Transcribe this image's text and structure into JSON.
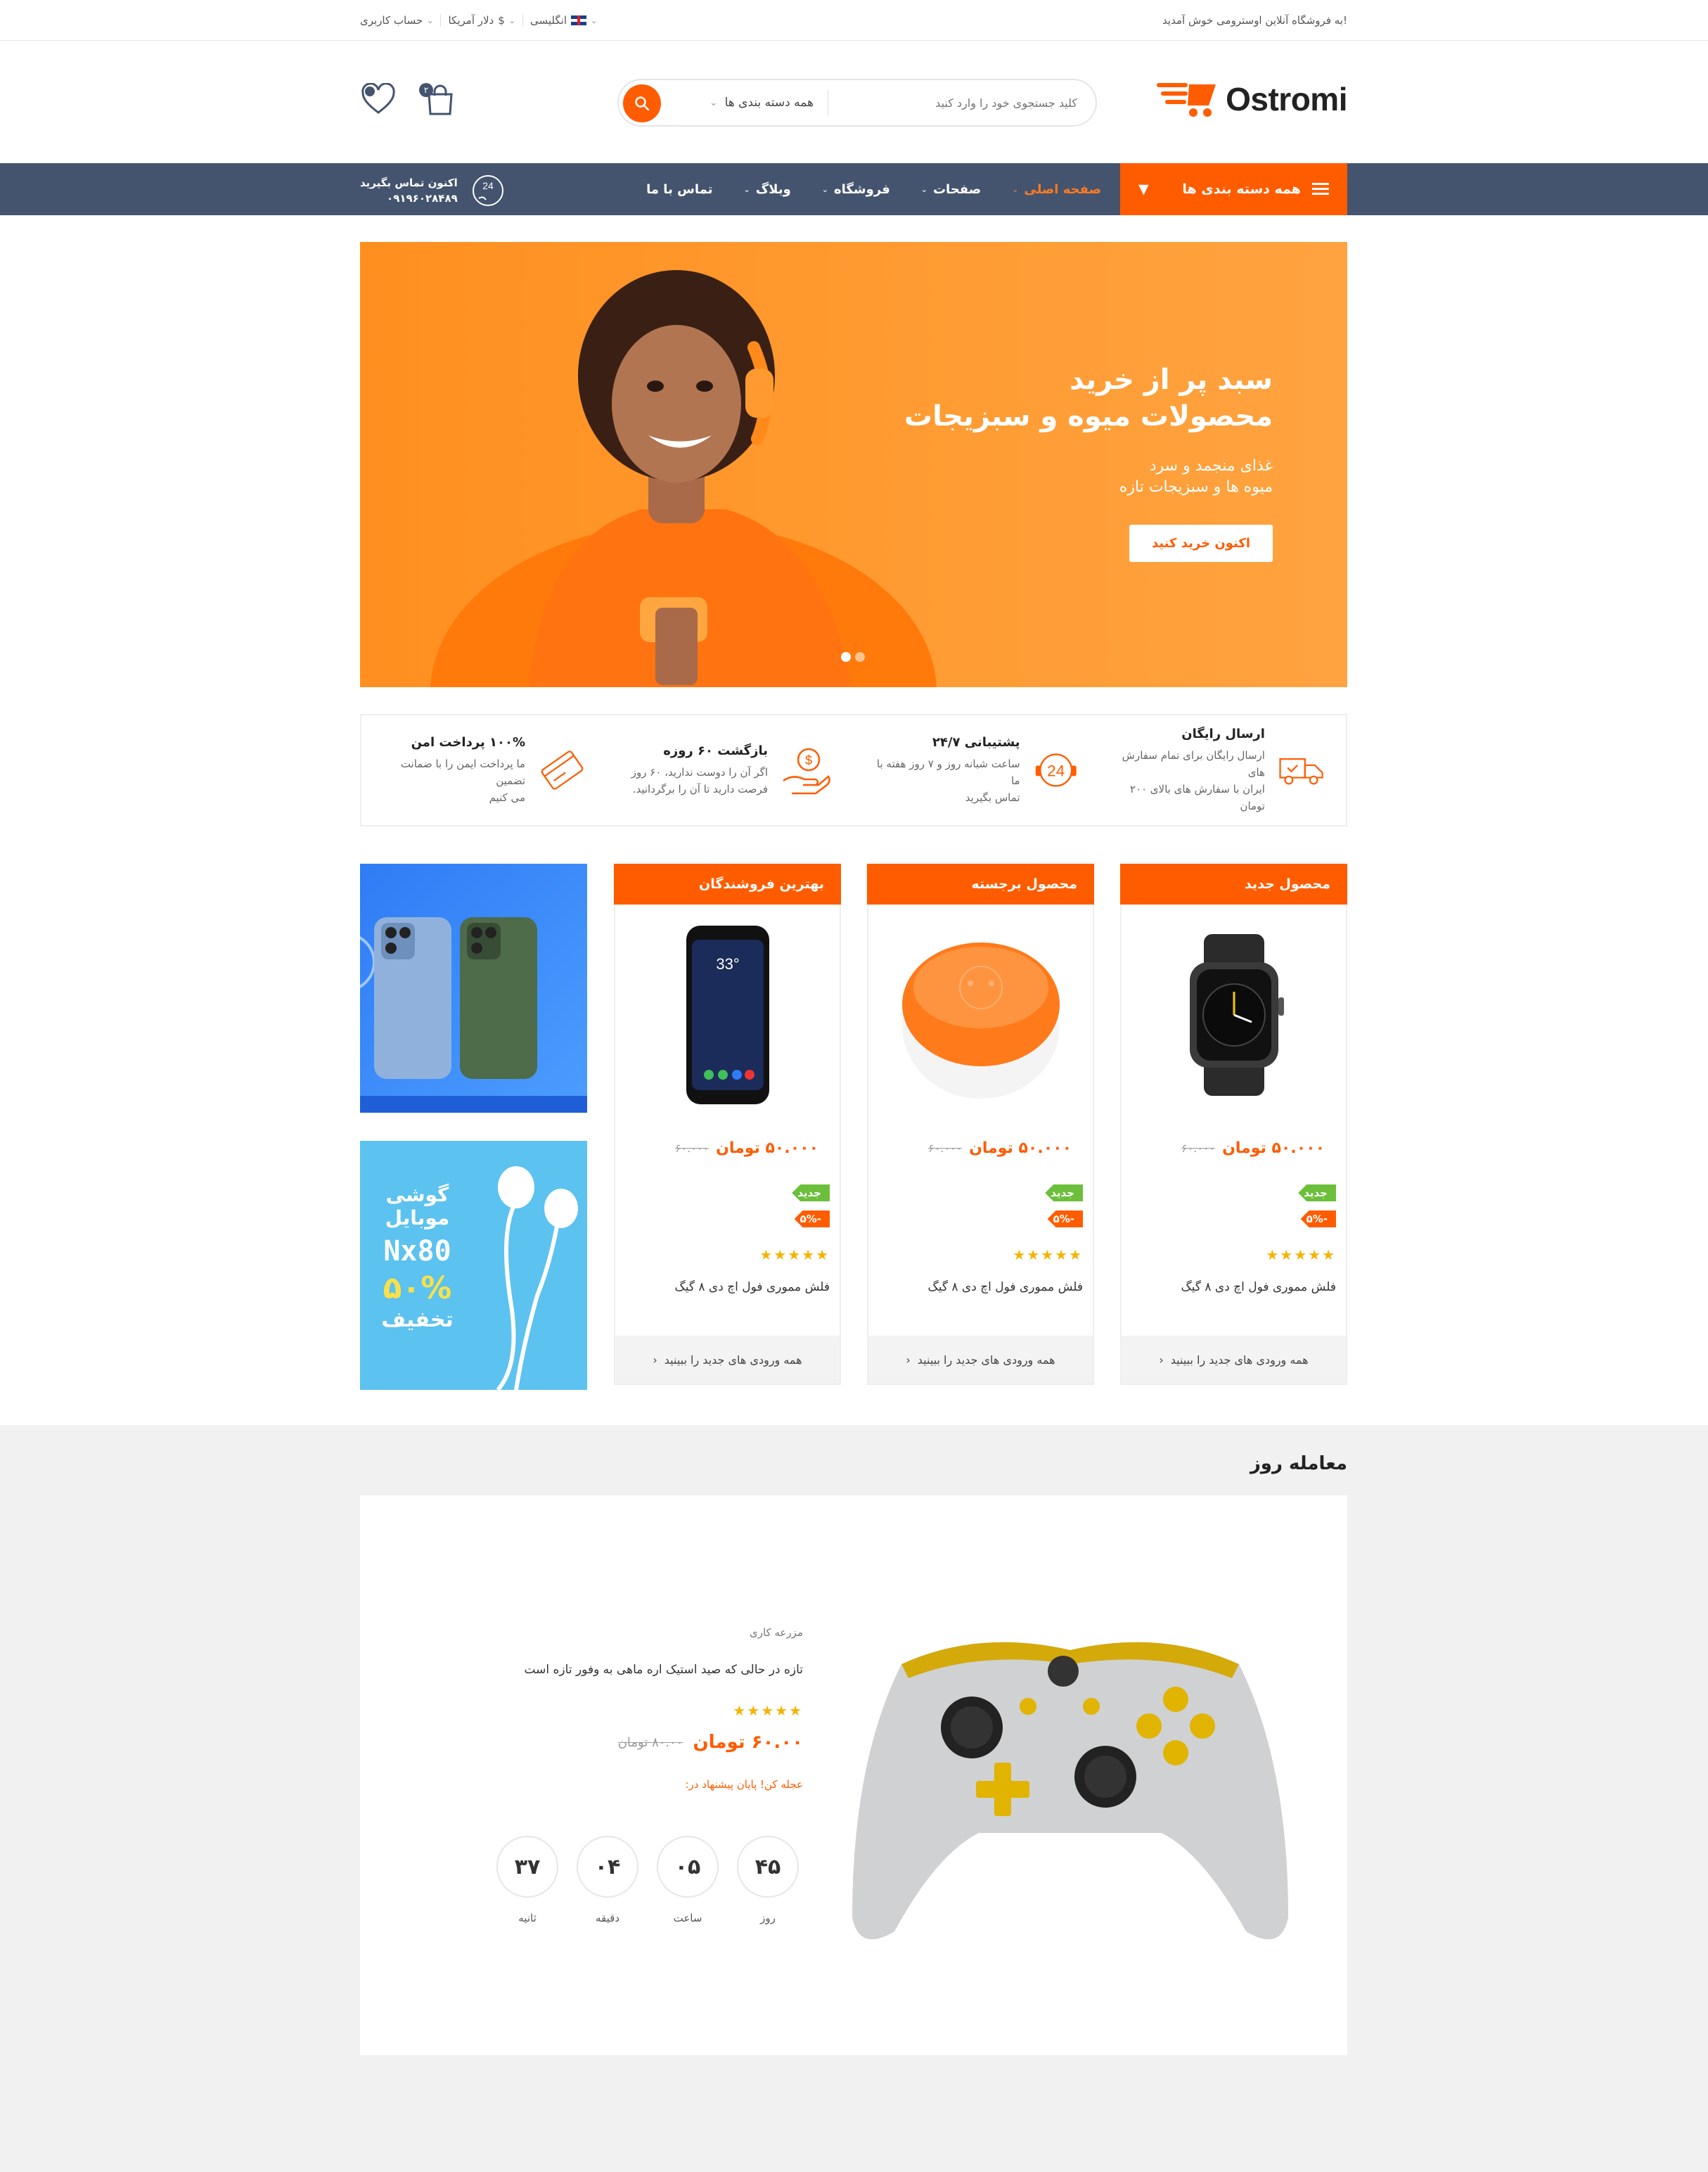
{
  "topbar": {
    "welcome": "به فروشگاه آنلاین اوسترومی خوش آمدید!",
    "account": "حساب کاربری",
    "currency": "دلار آمریکا",
    "language": "انگلیسی"
  },
  "header": {
    "logo": "Ostromi",
    "search_placeholder": "کلید جستجوی خود را وارد کنید",
    "search_category": "همه دسته بندی ها",
    "cart_count": "۲"
  },
  "nav": {
    "all_categories": "همه دسته بندی ها",
    "items": [
      {
        "label": "صفحه اصلی",
        "active": true,
        "dropdown": true
      },
      {
        "label": "صفحات",
        "active": false,
        "dropdown": true
      },
      {
        "label": "فروشگاه",
        "active": false,
        "dropdown": true
      },
      {
        "label": "وبلاگ",
        "active": false,
        "dropdown": true
      },
      {
        "label": "تماس با ما",
        "active": false,
        "dropdown": false
      }
    ],
    "contact_label": "اکنون تماس بگیرید",
    "contact_phone": "۰۹۱۹۶۰۲۸۴۸۹",
    "contact_icon_text": "24"
  },
  "hero": {
    "title_line1": "سبد پر از خرید",
    "title_line2": "محصولات میوه و سبزیجات",
    "sub_line1": "غذای منجمد و سرد",
    "sub_line2": "میوه ها و سبزیجات تازه",
    "button": "اکنون خرید کنید"
  },
  "features": [
    {
      "title": "ارسال رایگان",
      "desc1": "ارسال رایگان برای تمام سفارش های",
      "desc2": "ایران با سفارش های بالای ۲۰۰ تومان",
      "icon": "truck-icon"
    },
    {
      "title": "پشتیبانی ۲۴/۷",
      "desc1": "ساعت شبانه روز و ۷ روز هفته با ما",
      "desc2": "تماس بگیرید",
      "icon": "support-24-icon"
    },
    {
      "title": "بازگشت ۶۰ روزه",
      "desc1": "اگر آن را دوست ندارید، ۶۰ روز",
      "desc2": "فرصت دارید تا آن را برگردانید.",
      "icon": "money-back-icon"
    },
    {
      "title": "۱۰۰% پرداخت امن",
      "desc1": "ما پرداخت ایمن را با ضمانت تضمین",
      "desc2": "می کنیم",
      "icon": "secure-card-icon"
    }
  ],
  "product_columns": [
    {
      "heading": "محصول جدید",
      "image": "watch",
      "old_price": "۶۰.۰۰۰",
      "new_price": "۵۰.۰۰۰ تومان",
      "tag_new": "جدید",
      "tag_off": "-۵%",
      "stars": "★★★★★",
      "name": "فلش مموری فول اچ دی ۸ گیگ",
      "footer": "همه ورودی های جدید را ببینید"
    },
    {
      "heading": "محصول برجسته",
      "image": "speaker",
      "old_price": "۶۰.۰۰۰",
      "new_price": "۵۰.۰۰۰ تومان",
      "tag_new": "جدید",
      "tag_off": "-۵%",
      "stars": "★★★★★",
      "name": "فلش مموری فول اچ دی ۸ گیگ",
      "footer": "همه ورودی های جدید را ببینید"
    },
    {
      "heading": "بهترین فروشندگان",
      "image": "phone",
      "old_price": "۶۰.۰۰۰",
      "new_price": "۵۰.۰۰۰ تومان",
      "tag_new": "جدید",
      "tag_off": "-۵%",
      "stars": "★★★★★",
      "name": "فلش مموری فول اچ دی ۸ گیگ",
      "footer": "همه ورودی های جدید را ببینید"
    }
  ],
  "banner2": {
    "line1": "گوشی موبایل",
    "line2": "Nx80",
    "line3": "۵۰%",
    "line4": "تخفیف"
  },
  "phone_screen": {
    "temp": "33°"
  },
  "deal": {
    "section_title": "معامله روز",
    "category": "مزرعه کاری",
    "name": "تازه در حالی که صید استیک اره ماهی به وفور تازه است",
    "stars": "★★★★★",
    "old_price": "۸۰.۰۰ تومان",
    "new_price": "۶۰.۰۰ تومان",
    "hurry": "عجله کن! پایان پیشنهاد در:",
    "timer": [
      {
        "value": "۴۵",
        "label": "روز"
      },
      {
        "value": "۰۵",
        "label": "ساعت"
      },
      {
        "value": "۰۴",
        "label": "دقیقه"
      },
      {
        "value": "۳۷",
        "label": "ثانیه"
      }
    ]
  },
  "colors": {
    "accent": "#ff5c00",
    "nav": "#44546f",
    "star": "#f5b400",
    "tag_green": "#6cbf3a"
  }
}
